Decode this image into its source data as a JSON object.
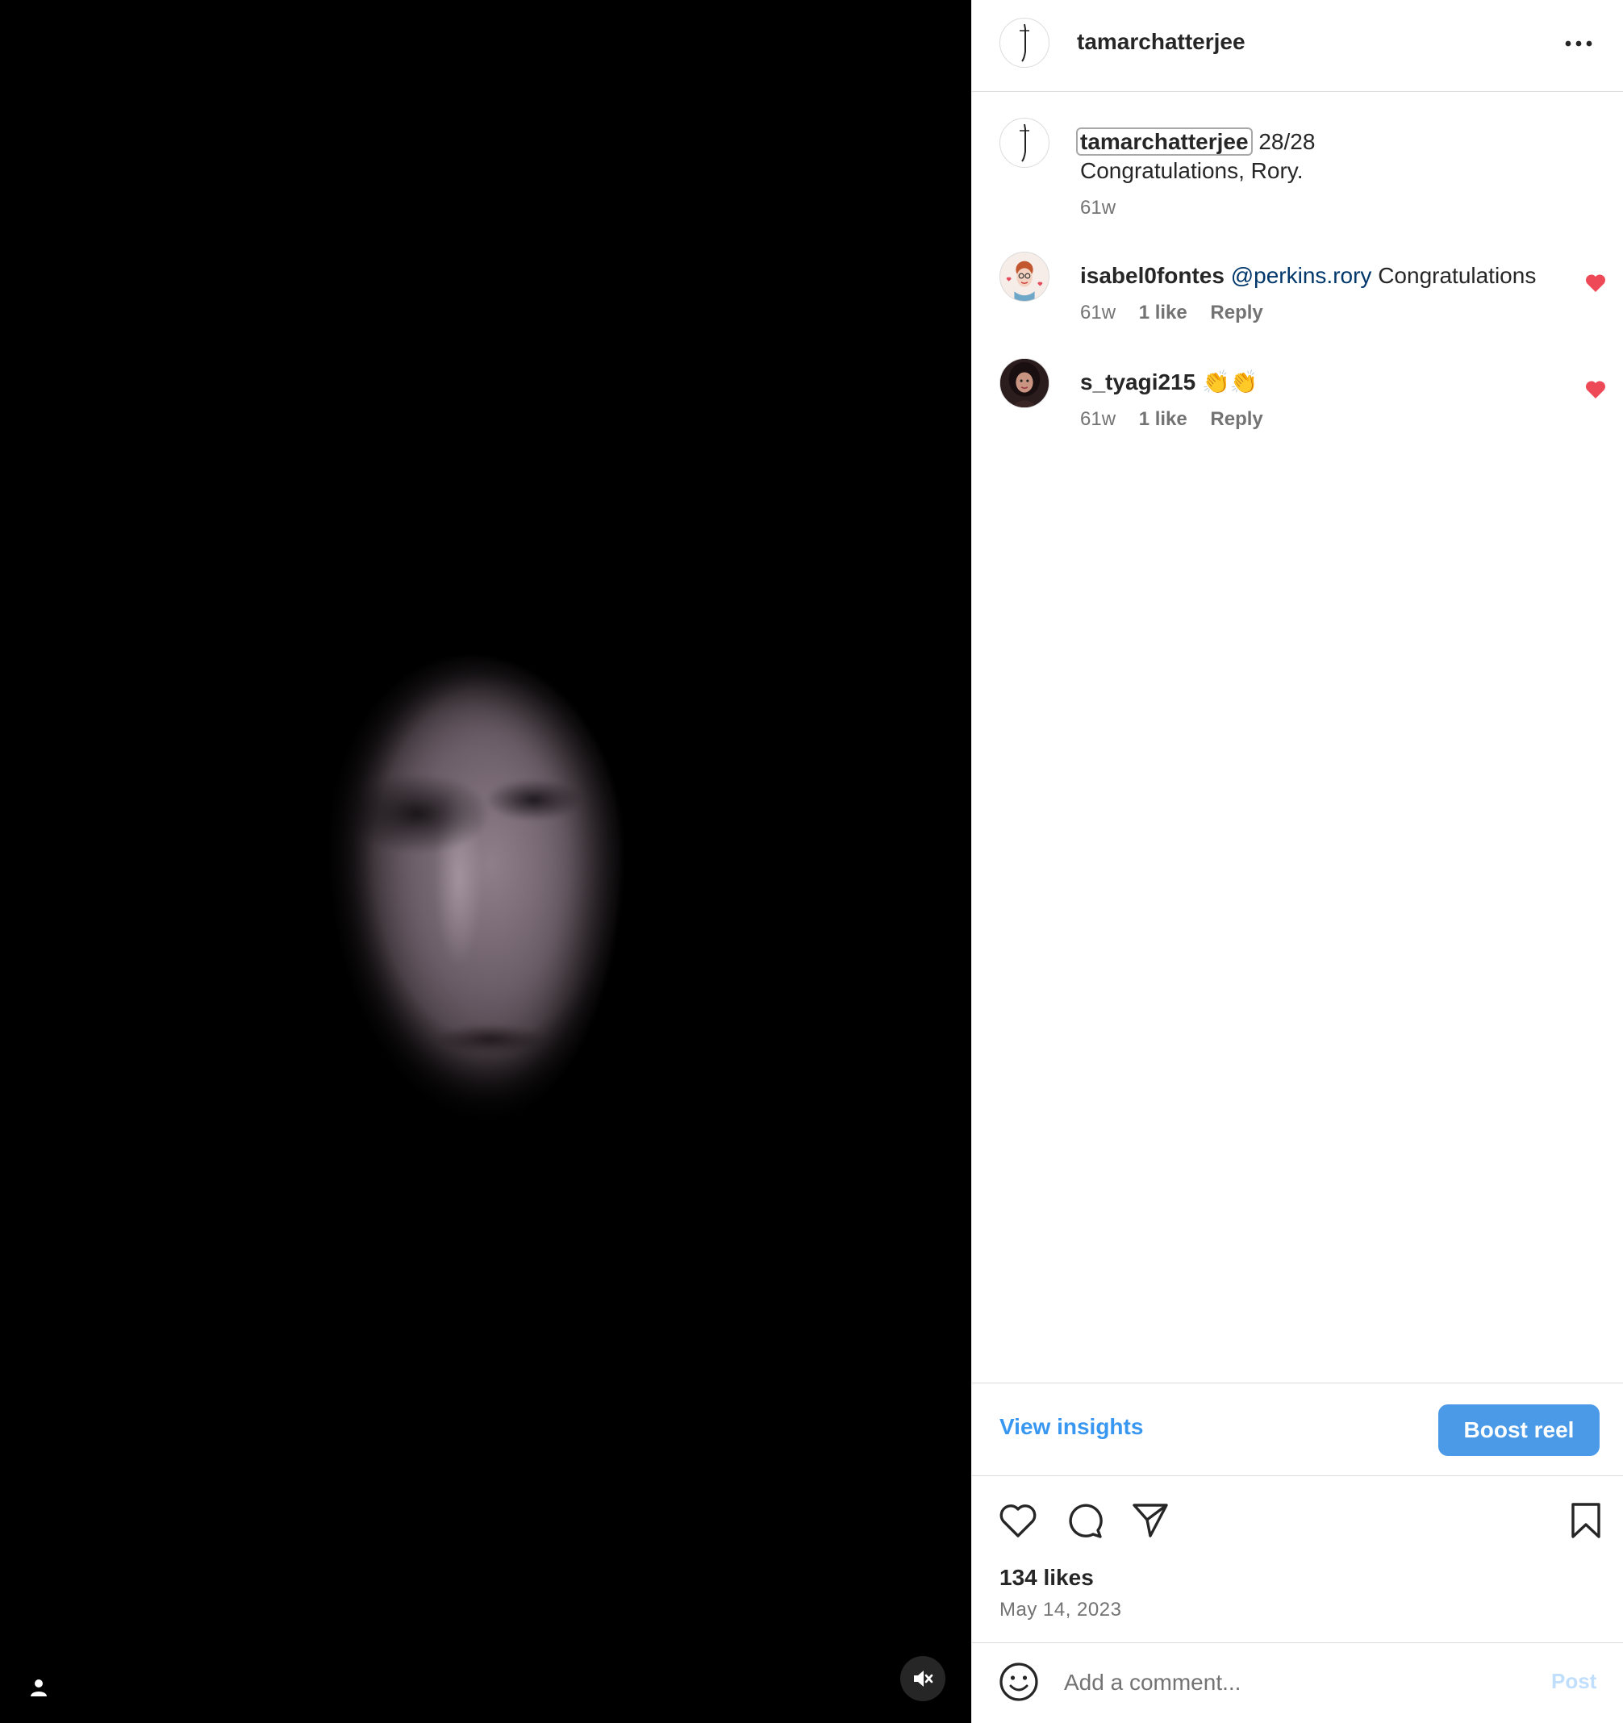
{
  "header": {
    "username": "tamarchatterjee"
  },
  "caption": {
    "username": "tamarchatterjee",
    "text": "28/28",
    "text_line2": "Congratulations, Rory.",
    "time": "61w"
  },
  "comments": [
    {
      "username": "isabel0fontes",
      "mention": "@perkins.rory",
      "text": "Congratulations",
      "time": "61w",
      "likes": "1 like",
      "reply": "Reply",
      "liked": true
    },
    {
      "username": "s_tyagi215",
      "text": "👏👏",
      "time": "61w",
      "likes": "1 like",
      "reply": "Reply",
      "liked": true
    }
  ],
  "insights": {
    "view_label": "View insights",
    "boost_label": "Boost reel"
  },
  "stats": {
    "likes": "134 likes",
    "date": "May 14, 2023"
  },
  "composer": {
    "placeholder": "Add a comment...",
    "post_label": "Post"
  },
  "colors": {
    "accent": "#0095f6",
    "like_red": "#ed4956",
    "media_bg": "#000000"
  },
  "icons": [
    "user-tag-icon",
    "muted-speaker-icon",
    "more-options-icon",
    "heart-icon",
    "comment-icon",
    "share-icon",
    "bookmark-icon",
    "emoji-icon"
  ]
}
